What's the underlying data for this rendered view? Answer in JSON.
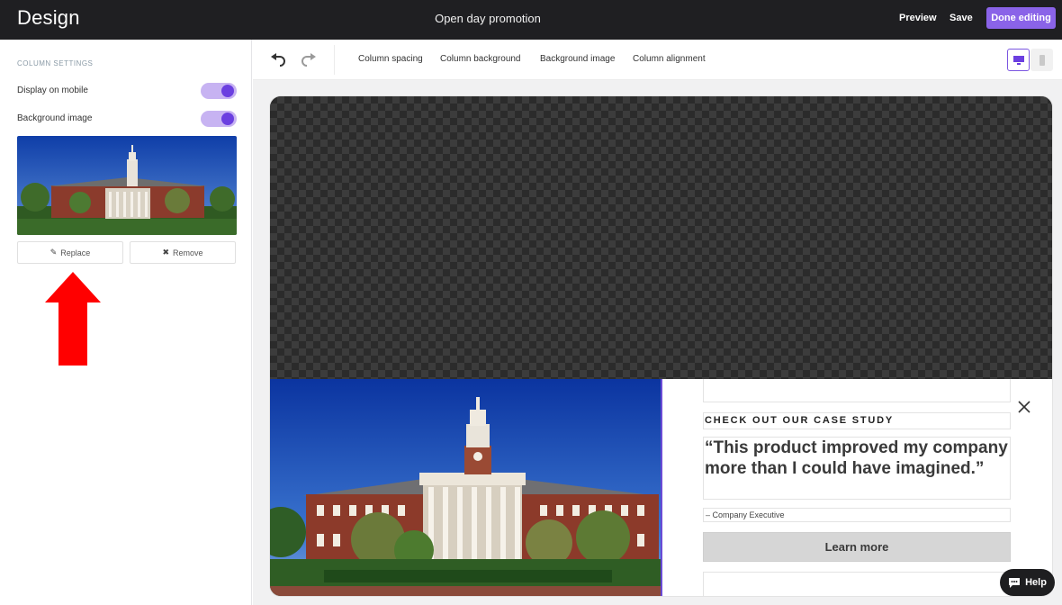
{
  "header": {
    "app_title": "Design",
    "document_title": "Open day promotion",
    "preview_label": "Preview",
    "save_label": "Save",
    "done_label": "Done editing"
  },
  "left_panel": {
    "heading": "COLUMN SETTINGS",
    "display_on_mobile_label": "Display on mobile",
    "display_on_mobile_on": true,
    "background_image_label": "Background image",
    "background_image_on": true,
    "replace_label": "Replace",
    "remove_label": "Remove"
  },
  "toolbar": {
    "items": [
      "Column spacing",
      "Column background",
      "Background image",
      "Column alignment"
    ],
    "active_device": "desktop"
  },
  "content": {
    "eyebrow": "CHECK OUT OUR CASE STUDY",
    "quote": "“This product improved my company more than I could have imagined.”",
    "attribution": "– Company Executive",
    "cta_label": "Learn more"
  },
  "help_label": "Help",
  "colors": {
    "accent": "#8a63e8",
    "toggle_track": "#c7b3f2",
    "toggle_knob": "#6b3fe0",
    "topbar": "#1f1f22",
    "arrow": "#ff0000"
  },
  "icons": [
    "undo-icon",
    "redo-icon",
    "desktop-icon",
    "mobile-icon",
    "pencil-icon",
    "x-icon",
    "close-icon",
    "chat-icon"
  ]
}
